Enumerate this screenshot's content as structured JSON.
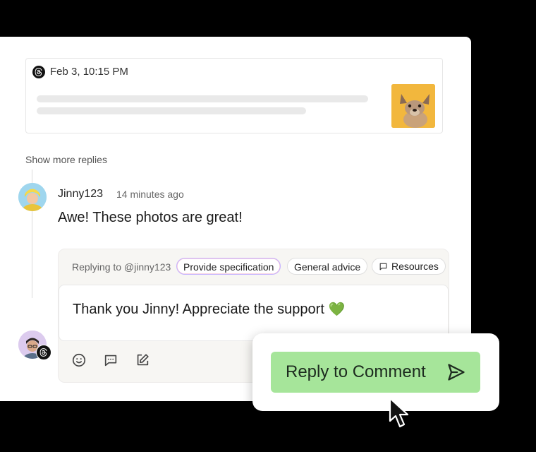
{
  "post": {
    "platform_icon": "threads-icon",
    "date": "Feb 3, 10:15 PM",
    "thumbnail": "french-bulldog-photo"
  },
  "thread": {
    "show_more_label": "Show more replies"
  },
  "comment": {
    "username": "Jinny123",
    "time_ago": "14 minutes ago",
    "text": "Awe! These photos are great!"
  },
  "reply": {
    "replying_to": "Replying to @jinny123",
    "chips": [
      {
        "label": "Provide specification"
      },
      {
        "label": "General advice"
      },
      {
        "label": "Resources",
        "icon": "message-square-icon"
      }
    ],
    "text": "Thank you Jinny! Appreciate the support",
    "emoji": "💚",
    "toolbar_icons": [
      "smile-icon",
      "message-dots-icon",
      "edit-icon"
    ]
  },
  "action": {
    "button_label": "Reply to Comment",
    "button_icon": "send-icon",
    "button_color": "#a6e59a"
  }
}
